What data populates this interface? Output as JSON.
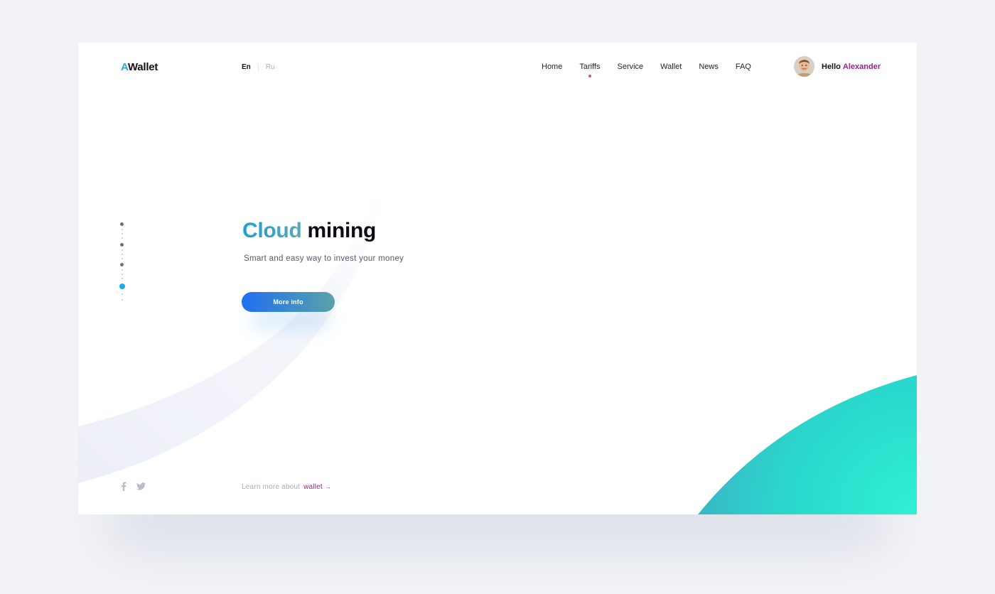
{
  "brand": {
    "logo_accent": "A",
    "logo_rest": "Wallet",
    "accent_color": "#2ea7d6"
  },
  "languages": {
    "active": "En",
    "inactive": "Ru"
  },
  "nav": {
    "items": [
      {
        "label": "Home",
        "active": false
      },
      {
        "label": "Tariffs",
        "active": true
      },
      {
        "label": "Service",
        "active": false
      },
      {
        "label": "Wallet",
        "active": false
      },
      {
        "label": "News",
        "active": false
      },
      {
        "label": "FAQ",
        "active": false
      }
    ]
  },
  "user": {
    "greeting": "Hello",
    "name": "Alexander",
    "avatar_icon": "user-avatar"
  },
  "pager": {
    "count": 4,
    "active_index": 3
  },
  "hero": {
    "title_highlight": "Cloud",
    "title_rest": "mining",
    "subtitle": "Smart and easy way to invest your money",
    "cta_label": "More info"
  },
  "footer": {
    "social_icons": [
      "facebook-icon",
      "twitter-icon"
    ],
    "learn_prefix": "Learn more about",
    "learn_link": "wallet",
    "learn_arrow": "→"
  },
  "colors": {
    "link_purple": "#9a1f8c",
    "pager_active": "#17b0e6",
    "button_start": "#1f6ff2",
    "button_end": "#5aa3a8",
    "blob_start": "#3d8fb3",
    "blob_end": "#2ef0d4"
  }
}
